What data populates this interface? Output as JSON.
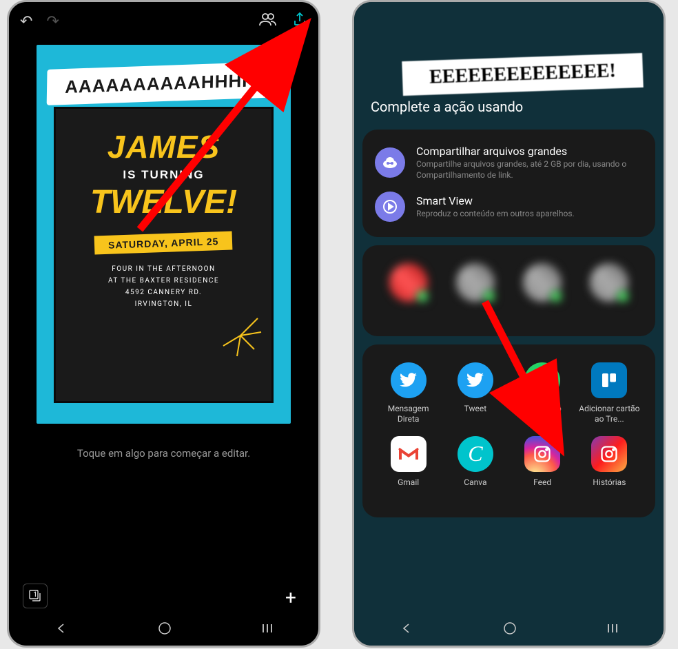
{
  "left": {
    "poster": {
      "banner": "AAAAAAAAAAHHHH!",
      "name": "JAMES",
      "turning": "IS TURNING",
      "age": "TWELVE!",
      "date": "SATURDAY, APRIL 25",
      "line1": "FOUR IN THE AFTERNOON",
      "line2": "AT THE BAXTER RESIDENCE",
      "line3": "4592 CANNERY RD.",
      "line4": "IRVINGTON, IL"
    },
    "editPrompt": "Toque em algo para começar a editar.",
    "pageCount": "1"
  },
  "right": {
    "bgBanner": "EEEEEEEEEEEEEE!",
    "sheetTitle": "Complete a ação usando",
    "options": [
      {
        "title": "Compartilhar arquivos grandes",
        "sub": "Compartilhe arquivos grandes, até 2 GB por dia, usando o Compartilhamento de link."
      },
      {
        "title": "Smart View",
        "sub": "Reproduz o conteúdo em outros aparelhos."
      }
    ],
    "apps": [
      {
        "label": "Mensagem Direta",
        "color": "twitter"
      },
      {
        "label": "Tweet",
        "color": "twitter"
      },
      {
        "label": "WhatsApp",
        "color": "whatsapp"
      },
      {
        "label": "Adicionar cartão ao Tre...",
        "color": "trello"
      },
      {
        "label": "Gmail",
        "color": "gmail"
      },
      {
        "label": "Canva",
        "color": "canva"
      },
      {
        "label": "Feed",
        "color": "instagram"
      },
      {
        "label": "Histórias",
        "color": "insta-st"
      }
    ]
  }
}
